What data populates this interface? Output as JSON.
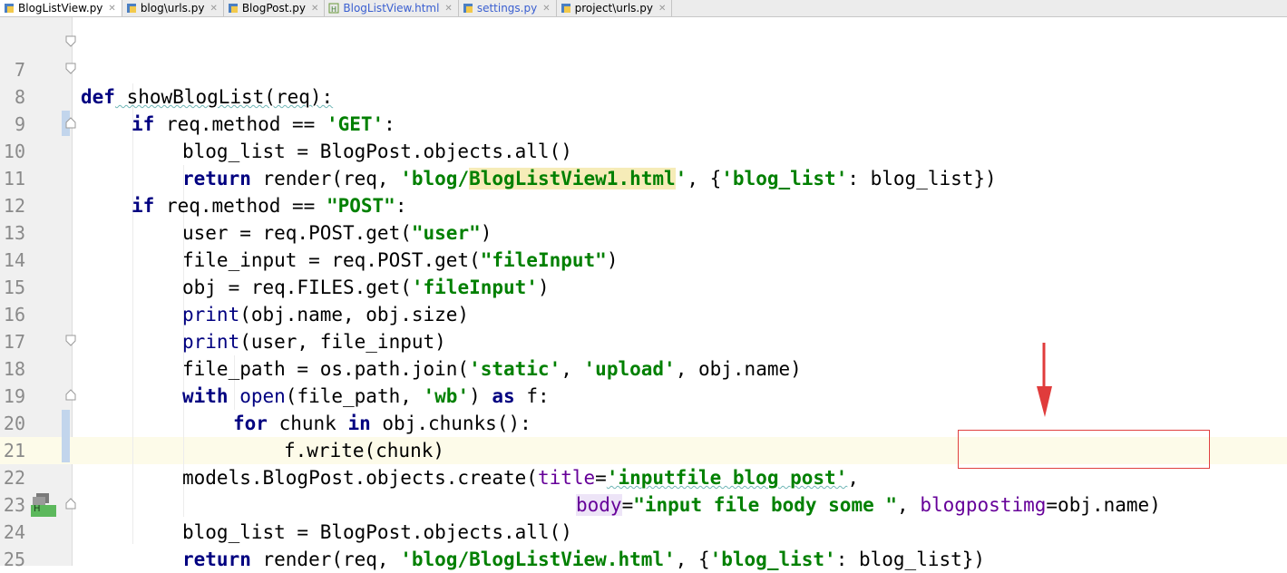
{
  "tabs": [
    {
      "label": "BlogListView.py",
      "active": true,
      "icon": "python-file-icon"
    },
    {
      "label": "blog\\urls.py",
      "active": false,
      "icon": "python-file-icon"
    },
    {
      "label": "BlogPost.py",
      "active": false,
      "icon": "python-file-icon"
    },
    {
      "label": "BlogListView.html",
      "active": false,
      "icon": "html-file-icon"
    },
    {
      "label": "settings.py",
      "active": false,
      "icon": "python-file-icon"
    },
    {
      "label": "project\\urls.py",
      "active": false,
      "icon": "python-file-icon"
    }
  ],
  "line_numbers": [
    "7",
    "8",
    "9",
    "10",
    "11",
    "12",
    "13",
    "14",
    "15",
    "16",
    "17",
    "18",
    "19",
    "20",
    "21",
    "22",
    "23",
    "24",
    "25"
  ],
  "code": {
    "l7": {
      "def": "def",
      "fn": " showBlogList(req):"
    },
    "l8": {
      "if": "if",
      "a": " req.method == ",
      "s": "'GET'",
      "b": ":"
    },
    "l9": {
      "a": "blog_list = BlogPost.objects.all()"
    },
    "l10": {
      "ret": "return",
      "a": " render(req, ",
      "s1": "'blog/",
      "s2": "BlogListView1.html",
      "s3": "'",
      "b": ", {",
      "s4": "'blog_list'",
      "c": ": blog_list})"
    },
    "l11": {
      "if": "if",
      "a": " req.method == ",
      "s": "\"POST\"",
      "b": ":"
    },
    "l12": {
      "a": "user = req.POST.get(",
      "s": "\"user\"",
      "b": ")"
    },
    "l13": {
      "a": "file_input = req.POST.get(",
      "s": "\"fileInput\"",
      "b": ")"
    },
    "l14": {
      "a": "obj = req.FILES.get(",
      "s": "'fileInput'",
      "b": ")"
    },
    "l15": {
      "p": "print",
      "a": "(obj.name, obj.size)"
    },
    "l16": {
      "p": "print",
      "a": "(user, file_input)"
    },
    "l17": {
      "a": "file_path = os.path.join(",
      "s1": "'static'",
      "b": ", ",
      "s2": "'upload'",
      "c": ", obj.name)"
    },
    "l18": {
      "with": "with",
      "open": " open",
      "a": "(file_path, ",
      "s": "'wb'",
      "b": ") ",
      "as": "as",
      "c": " f:"
    },
    "l19": {
      "for": "for",
      "a": " chunk ",
      "in": "in",
      "b": " obj.chunks():"
    },
    "l20": {
      "a": "f.write(chunk)"
    },
    "l21": {
      "a": "models.BlogPost.objects.create(",
      "p": "title",
      "b": "=",
      "s": "'inputfile blog post'",
      "c": ","
    },
    "l22": {
      "p1": "body",
      "a": "=",
      "s": "\"input file body some \"",
      "b": ", ",
      "p2": "blogpostimg",
      "c": "=obj.name)"
    },
    "l23": {
      "a": "blog_list = BlogPost.objects.all()"
    },
    "l24": {
      "ret": "return",
      "a": " render(req, ",
      "s1": "'blog/BlogListView.html'",
      "b": ", {",
      "s2": "'blog_list'",
      "c": ": blog_list})"
    }
  },
  "badge_letter": "H",
  "colors": {
    "annotation": "#e03c3c",
    "keyword": "#000080",
    "string": "#008000",
    "param": "#660099"
  }
}
